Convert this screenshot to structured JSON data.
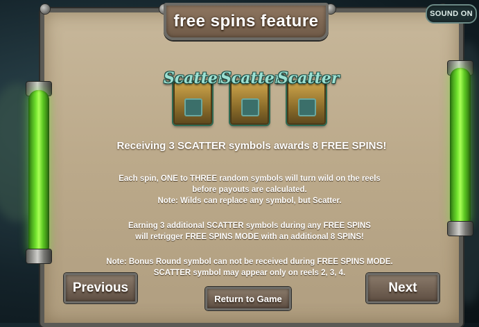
{
  "title": "free spins feature",
  "sound_button": "SOUND ON",
  "scatter_symbols": [
    "Scatter",
    "Scatter",
    "Scatter"
  ],
  "headline": "Receiving 3 SCATTER symbols awards 8 FREE SPINS!",
  "paragraph1": [
    "Each spin, ONE to THREE random symbols will turn wild on the reels",
    "before payouts are calculated.",
    "Note: Wilds can replace any symbol, but Scatter."
  ],
  "paragraph2": [
    "Earning 3 additional SCATTER symbols during any FREE SPINS",
    "will retrigger FREE SPINS MODE with an additional 8 SPINS!"
  ],
  "paragraph3": [
    "Note: Bonus Round symbol can not be received during FREE SPINS MODE.",
    "SCATTER symbol may appear only on reels 2, 3, 4."
  ],
  "buttons": {
    "previous": "Previous",
    "next": "Next",
    "return": "Return to Game"
  },
  "colors": {
    "panel": "#bba98a",
    "tube_glow": "#6fe02d",
    "scatter_text": "#9de0d2"
  }
}
